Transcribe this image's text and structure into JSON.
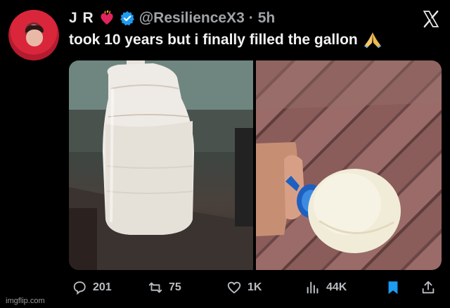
{
  "author": {
    "name": "J R",
    "handle": "@ResilienceX3",
    "time": "5h",
    "separator": "·"
  },
  "tweet": {
    "text": "took 10 years but i finally filled the gallon"
  },
  "actions": {
    "replies": "201",
    "retweets": "75",
    "likes": "1K",
    "views": "44K"
  },
  "icons": [
    "heart-fire-icon",
    "verified-icon",
    "x-logo-icon",
    "praying-hands-icon",
    "reply-icon",
    "retweet-icon",
    "like-icon",
    "views-icon",
    "bookmark-icon",
    "share-icon"
  ],
  "colors": {
    "background": "#000000",
    "verified": "#1d9bf0",
    "bookmark_active": "#1d9bf0",
    "muted": "#b9bec3"
  },
  "watermark": "imgflip.com"
}
